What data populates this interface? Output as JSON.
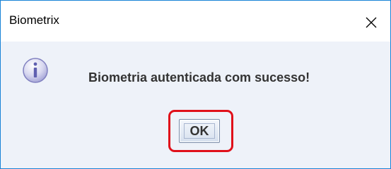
{
  "window": {
    "title": "Biometrix"
  },
  "dialog": {
    "message": "Biometria autenticada com sucesso!",
    "icon": "info-icon",
    "ok_label": "OK"
  },
  "colors": {
    "highlight": "#e0101a",
    "window_border": "#1883d7"
  }
}
